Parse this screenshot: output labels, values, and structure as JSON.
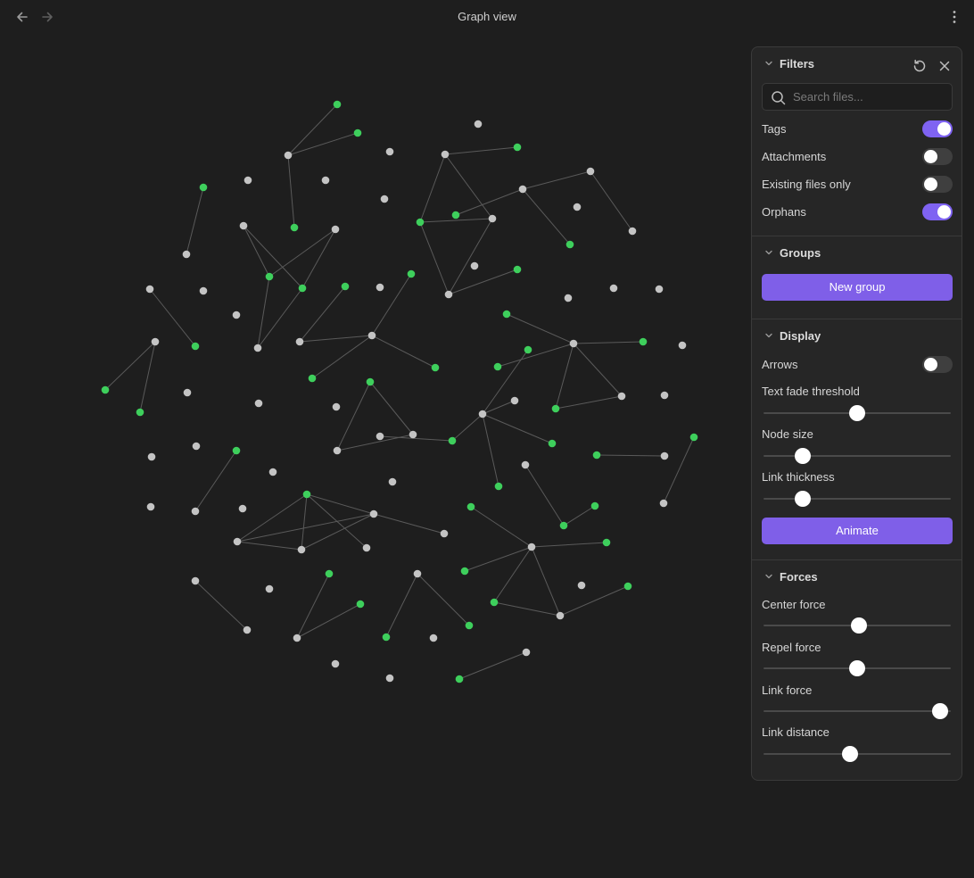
{
  "window": {
    "title": "Graph view"
  },
  "nav": {
    "back_icon": "arrow-left-icon",
    "forward_icon": "arrow-right-icon",
    "more_icon": "more-vertical-icon"
  },
  "colors": {
    "background": "#1e1e1e",
    "panel": "#262626",
    "accent": "#7f5fe8",
    "node_default": "#c4c4c4",
    "node_tag": "#3ecf5c",
    "link": "#5a5a5a"
  },
  "panel": {
    "filters": {
      "title": "Filters",
      "reset_icon": "rotate-ccw-icon",
      "close_icon": "close-icon",
      "search_placeholder": "Search files...",
      "search_value": "",
      "toggles": [
        {
          "label": "Tags",
          "on": true
        },
        {
          "label": "Attachments",
          "on": false
        },
        {
          "label": "Existing files only",
          "on": false
        },
        {
          "label": "Orphans",
          "on": true
        }
      ]
    },
    "groups": {
      "title": "Groups",
      "new_group_label": "New group"
    },
    "display": {
      "title": "Display",
      "arrows_label": "Arrows",
      "arrows_on": false,
      "sliders": [
        {
          "label": "Text fade threshold",
          "value": 0.5
        },
        {
          "label": "Node size",
          "value": 0.2
        },
        {
          "label": "Link thickness",
          "value": 0.2
        }
      ],
      "animate_label": "Animate"
    },
    "forces": {
      "title": "Forces",
      "sliders": [
        {
          "label": "Center force",
          "value": 0.51
        },
        {
          "label": "Repel force",
          "value": 0.5
        },
        {
          "label": "Link force",
          "value": 0.96
        },
        {
          "label": "Link distance",
          "value": 0.46
        }
      ]
    }
  }
}
